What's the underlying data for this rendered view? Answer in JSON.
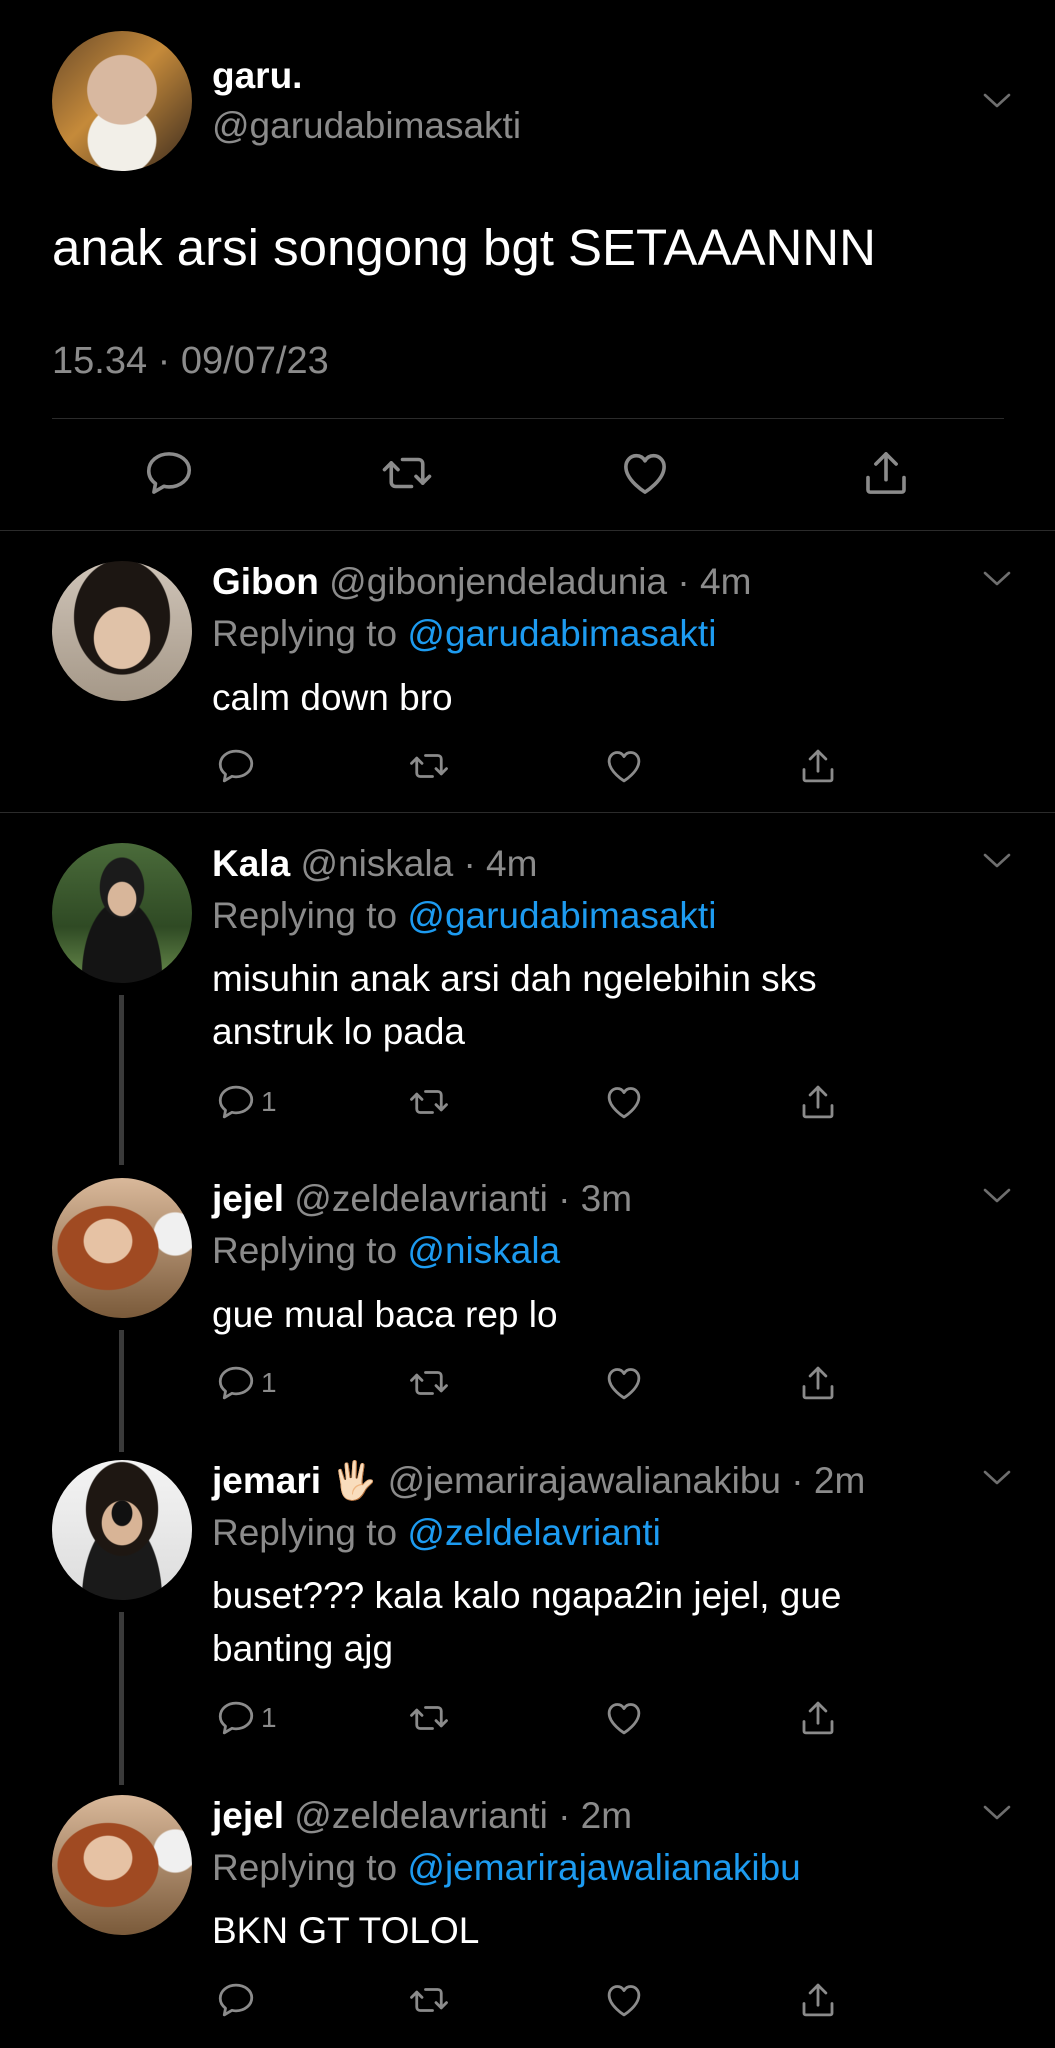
{
  "tweet": {
    "display_name": "garu.",
    "handle": "@garudabimasakti",
    "text": "anak arsi songong bgt SETAAANNN",
    "timestamp": "15.34 · 09/07/23"
  },
  "replies": [
    {
      "name": "Gibon",
      "handle": "@gibonjendeladunia",
      "time": "· 4m",
      "replying_prefix": "Replying to",
      "replying_to": "@garudabimasakti",
      "text": "calm down bro",
      "reply_count": ""
    },
    {
      "name": "Kala",
      "handle": "@niskala",
      "time": "· 4m",
      "replying_prefix": "Replying to",
      "replying_to": "@garudabimasakti",
      "text": "misuhin anak arsi dah ngelebihin sks anstruk lo pada",
      "reply_count": "1"
    },
    {
      "name": "jejel",
      "handle": "@zeldelavrianti",
      "time": "· 3m",
      "replying_prefix": "Replying to",
      "replying_to": "@niskala",
      "text": "gue mual baca rep lo",
      "reply_count": "1"
    },
    {
      "name": "jemari",
      "emoji": "🖐🏻",
      "handle": "@jemarirajawalianakibu",
      "time": "· 2m",
      "replying_prefix": "Replying to",
      "replying_to": "@zeldelavrianti",
      "text": "buset??? kala kalo ngapa2in jejel, gue banting ajg",
      "reply_count": "1"
    },
    {
      "name": "jejel",
      "handle": "@zeldelavrianti",
      "time": "· 2m",
      "replying_prefix": "Replying to",
      "replying_to": "@jemarirajawalianakibu",
      "text": "BKN GT TOLOL",
      "reply_count": ""
    }
  ],
  "icons": [
    "chevron-down-icon",
    "reply-icon",
    "retweet-icon",
    "like-icon",
    "share-icon"
  ],
  "colors": {
    "background": "#000000",
    "text": "#ffffff",
    "muted": "#8b8b8b",
    "link": "#1d9bf0"
  }
}
